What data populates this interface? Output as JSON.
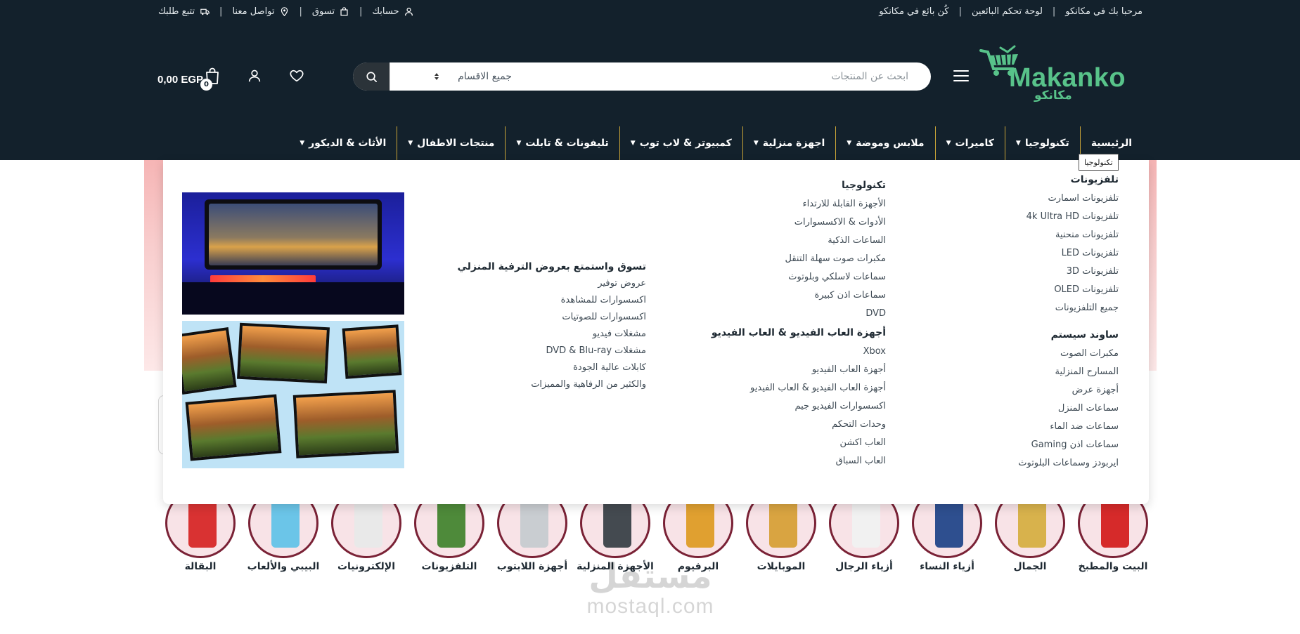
{
  "topbar": {
    "right_links": [
      {
        "label": "مرحبا بك في مكانكو"
      },
      {
        "label": "لوحة تحكم البائعين"
      },
      {
        "label": "كُن بائع في مكانكو"
      }
    ],
    "left_links": [
      {
        "label": "حسابك",
        "icon": "user-icon"
      },
      {
        "label": "تسوق",
        "icon": "shopping-bag-icon"
      },
      {
        "label": "تواصل معنا",
        "icon": "location-pin-icon"
      },
      {
        "label": "تتبع طلبك",
        "icon": "truck-icon"
      }
    ]
  },
  "brand": {
    "name_en": "Makanko",
    "name_ar": "مكانكو",
    "color": "#58c38a"
  },
  "search": {
    "placeholder": "ابحث عن المنتجات",
    "category": "جميع الاقسام"
  },
  "cart": {
    "total": "0,00 EGP",
    "count": "0"
  },
  "nav": [
    {
      "label": "الرئيسية",
      "caret": false
    },
    {
      "label": "تكنولوجيا",
      "caret": true
    },
    {
      "label": "كاميرات",
      "caret": true
    },
    {
      "label": "ملابس وموضة",
      "caret": true
    },
    {
      "label": "اجهزة منزلية",
      "caret": true
    },
    {
      "label": "كمبيوتر & لاب توب",
      "caret": true
    },
    {
      "label": "تليفونات & تابلت",
      "caret": true
    },
    {
      "label": "منتجات الاطفال",
      "caret": true
    },
    {
      "label": "الأثاث & الديكور",
      "caret": true
    }
  ],
  "tooltip": "تكنولوجيا",
  "mega": {
    "col1": {
      "title1": "تلفزيونات",
      "links1": [
        "تلفزيونات اسمارت",
        "تلفزيونات 4k Ultra HD",
        "تلفزيونات منحنية",
        "تلفزيونات LED",
        "تلفزيونات 3D",
        "تلفزيونات OLED",
        "جميع التلفزيونات"
      ],
      "title2": "ساوند سيستم",
      "links2": [
        "مكبرات الصوت",
        "المسارح المنزلية",
        "أجهزة عرض",
        "سماعات المنزل",
        "سماعات ضد الماء",
        "سماعات اذن Gaming",
        "ايربودز وسماعات البلوتوث"
      ]
    },
    "col2": {
      "title1": "تكنولوجيا",
      "links1": [
        "الأجهزة القابلة للارتداء",
        "الأدوات & الاكسسوارات",
        "الساعات الذكية",
        "مكبرات صوت سهلة التنقل",
        "سماعات لاسلكي وبلوتوث",
        "سماعات اذن كبيرة",
        "DVD"
      ],
      "title2": "أجهزة العاب الفيديو & العاب الفيديو",
      "links2": [
        "Xbox",
        "أجهزة العاب الفيديو",
        "أجهزة العاب الفيديو & العاب الفيديو",
        "اكسسوارات الفيديو جيم",
        "وحدات التحكم",
        "العاب اكشن",
        "العاب السباق"
      ]
    },
    "col3": {
      "title": "تسوق واستمتع بعروض الترفية المنزلي",
      "links": [
        "عروض توفير",
        "اكسسوارات للمشاهدة",
        "اكسسوارات للصوتيات",
        "مشغلات فيديو",
        "مشغلات DVD & Blu-ray",
        "كابلات عالية الجودة",
        "والكثير من الرفاهية والمميزات"
      ]
    }
  },
  "categories": [
    {
      "label": "البيت والمطبخ",
      "color": "#d62a2a"
    },
    {
      "label": "الجمال",
      "color": "#d8b24c"
    },
    {
      "label": "أزياء النساء",
      "color": "#2e4f8f"
    },
    {
      "label": "أزياء الرجال",
      "color": "#f1f1f1"
    },
    {
      "label": "الموبايلات",
      "color": "#d9a441"
    },
    {
      "label": "البرفيوم",
      "color": "#e0a030"
    },
    {
      "label": "الأجهزة المنزلية",
      "color": "#444a50"
    },
    {
      "label": "أجهزة اللابتوب",
      "color": "#c9cdd1"
    },
    {
      "label": "التلفزيونات",
      "color": "#4e8a3a"
    },
    {
      "label": "الإلكترونيات",
      "color": "#e9e9e9"
    },
    {
      "label": "البيبي والألعاب",
      "color": "#6bc5e8"
    },
    {
      "label": "البقالة",
      "color": "#d93232"
    }
  ],
  "watermark": {
    "ar": "مستقل",
    "en": "mostaql.com"
  }
}
